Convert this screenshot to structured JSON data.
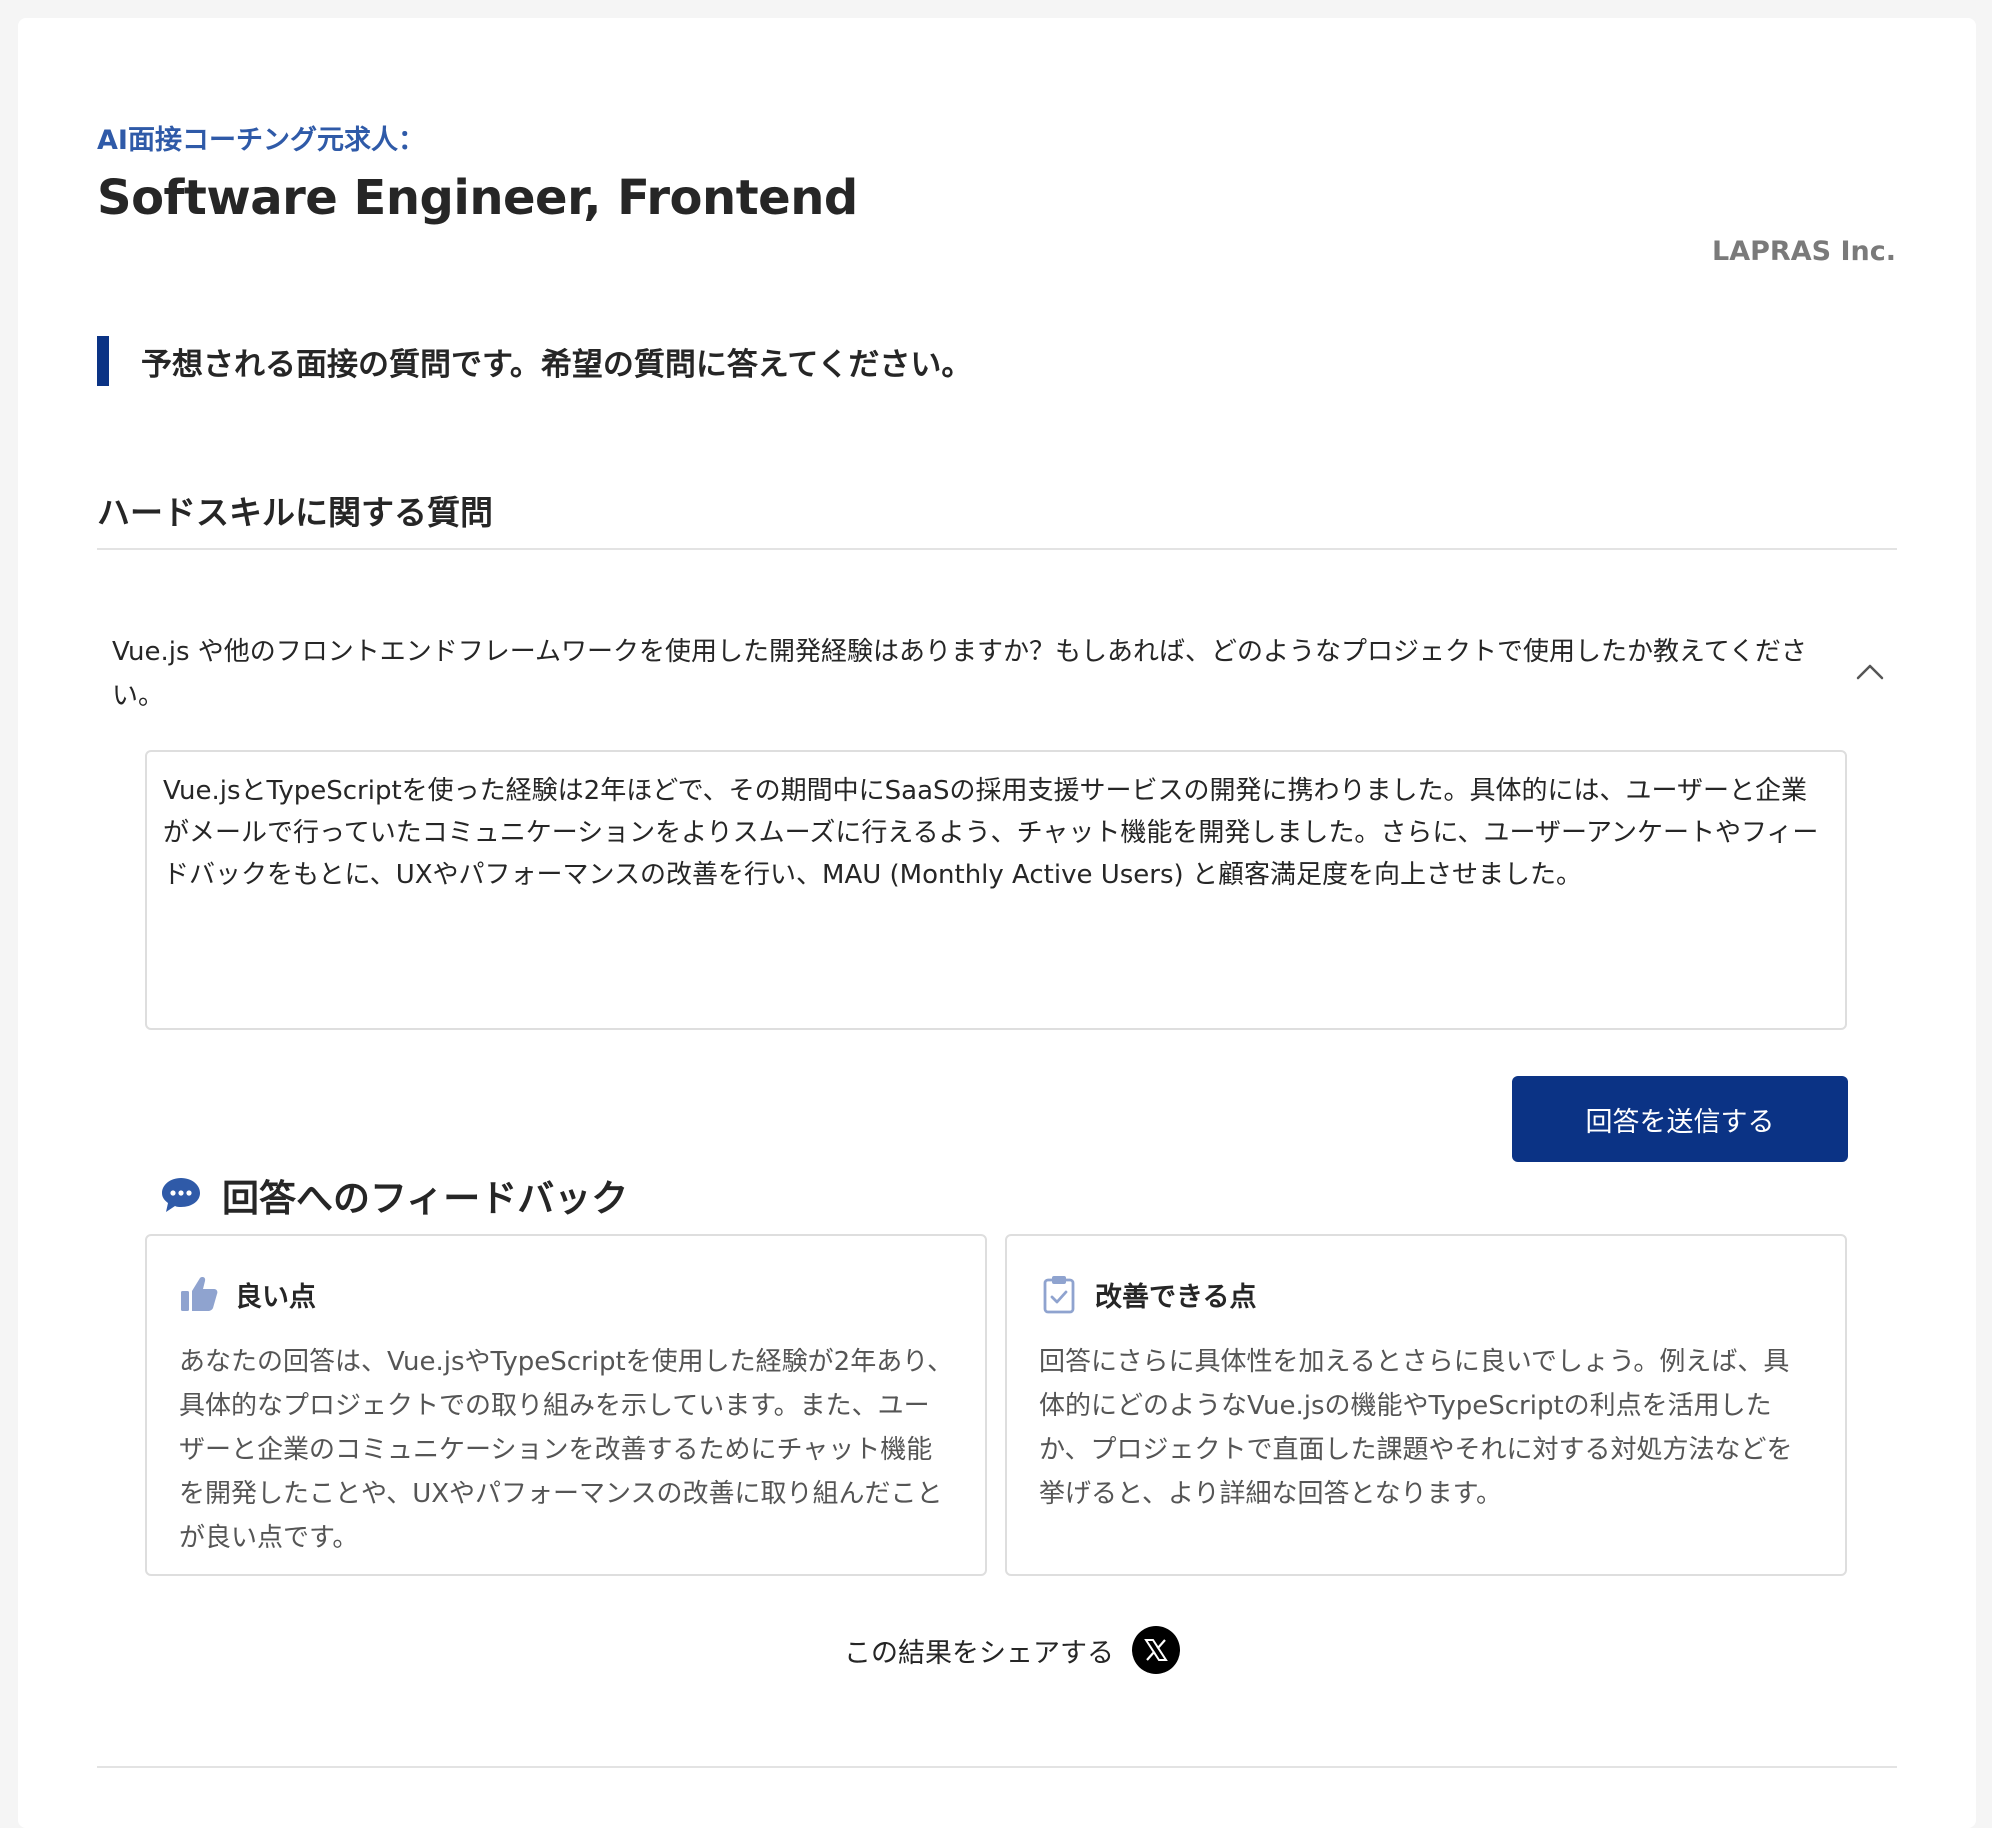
{
  "header": {
    "eyebrow": "AI面接コーチング元求人：",
    "job_title": "Software Engineer, Frontend",
    "company": "LAPRAS Inc."
  },
  "section": {
    "heading": "予想される面接の質問です。希望の質問に答えてください。"
  },
  "category": {
    "title": "ハードスキルに関する質問"
  },
  "question": {
    "text": "Vue.js や他のフロントエンドフレームワークを使用した開発経験はありますか？もしあれば、どのようなプロジェクトで使用したか教えてください。",
    "expanded_icon": "chevron-up-icon"
  },
  "answer": {
    "value": "Vue.jsとTypeScriptを使った経験は2年ほどで、その期間中にSaaSの採用支援サービスの開発に携わりました。具体的には、ユーザーと企業がメールで行っていたコミュニケーションをよりスムーズに行えるよう、チャット機能を開発しました。さらに、ユーザーアンケートやフィードバックをもとに、UXやパフォーマンスの改善を行い、MAU (Monthly Active Users) と顧客満足度を向上させました。",
    "submit_label": "回答を送信する"
  },
  "feedback": {
    "heading": "回答へのフィードバック",
    "heading_icon": "speech-bubble-icon",
    "good": {
      "icon": "thumbs-up-icon",
      "title": "良い点",
      "body": "あなたの回答は、Vue.jsやTypeScriptを使用した経験が2年あり、具体的なプロジェクトでの取り組みを示しています。また、ユーザーと企業のコミュニケーションを改善するためにチャット機能を開発したことや、UXやパフォーマンスの改善に取り組んだことが良い点です。"
    },
    "improve": {
      "icon": "clipboard-check-icon",
      "title": "改善できる点",
      "body": "回答にさらに具体性を加えるとさらに良いでしょう。例えば、具体的にどのようなVue.jsの機能やTypeScriptの利点を活用したか、プロジェクトで直面した課題やそれに対する対処方法などを挙げると、より詳細な回答となります。"
    }
  },
  "share": {
    "label": "この結果をシェアする",
    "icon": "x-logo-icon"
  },
  "colors": {
    "brand": "#0b3385",
    "eyebrow": "#2f5aa8",
    "icon_tint": "#8fa3cf",
    "muted_text": "#555555"
  }
}
